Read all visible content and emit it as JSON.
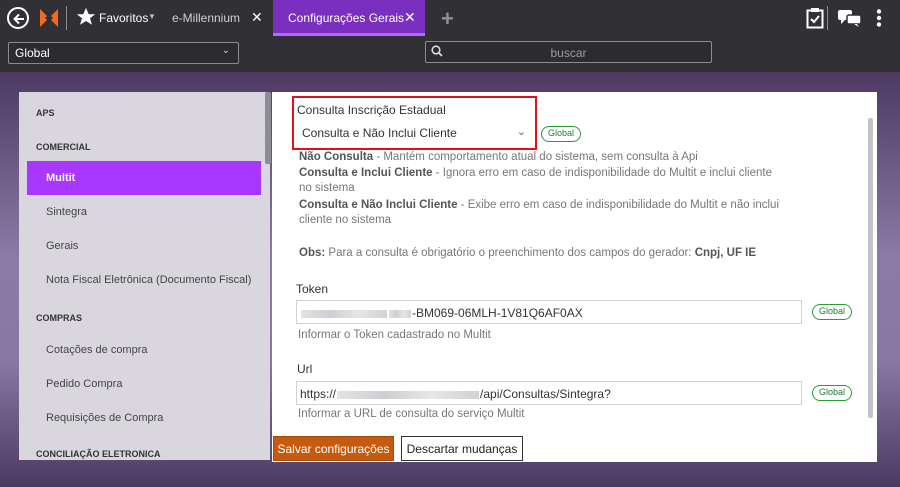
{
  "topbar": {
    "favorites_label": "Favoritos",
    "tabs": [
      {
        "label": "e-Millennium"
      },
      {
        "label": "Configurações Gerais"
      }
    ],
    "icons": {
      "back": "back-circle-icon",
      "logo": "millennium-logo-icon",
      "star": "star-icon",
      "add_tab": "plus-icon",
      "clipboard": "clipboard-check-icon",
      "chat": "chat-icon",
      "more": "more-vertical-icon"
    },
    "accent": "#7b2fbf"
  },
  "subbar": {
    "scope_select_value": "Global",
    "search_placeholder": "buscar"
  },
  "sidebar": {
    "sections": [
      {
        "header": "APS",
        "items": []
      },
      {
        "header": "COMERCIAL",
        "items": [
          {
            "label": "Multit",
            "active": true
          },
          {
            "label": "Sintegra"
          },
          {
            "label": "Gerais"
          },
          {
            "label": "Nota Fiscal Eletrônica (Documento Fiscal)"
          }
        ]
      },
      {
        "header": "COMPRAS",
        "items": [
          {
            "label": "Cotações de compra"
          },
          {
            "label": "Pedido Compra"
          },
          {
            "label": "Requisições de Compra"
          }
        ]
      },
      {
        "header": "CONCILIAÇÃO ELETRONICA",
        "items": []
      }
    ],
    "active_color": "#a838ff"
  },
  "form": {
    "consulta": {
      "label": "Consulta Inscrição Estadual",
      "value": "Consulta e Não Inclui Cliente",
      "badge": "Global",
      "descriptions": [
        {
          "bold": "Não Consulta",
          "text": " - Mantém comportamento atual do sistema, sem consulta à Api"
        },
        {
          "bold": "Consulta e Inclui Cliente",
          "text": " - Ignora erro em caso de indisponibilidade do Multit e inclui cliente no sistema"
        },
        {
          "bold": "Consulta e Não Inclui Cliente",
          "text": " - Exibe erro em caso de indisponibilidade do Multit e não inclui cliente no sistema"
        }
      ],
      "obs_label": "Obs:",
      "obs_text": " Para a consulta é obrigatório o preenchimento dos campos do gerador: ",
      "obs_fields": "Cnpj, UF IE"
    },
    "token": {
      "label": "Token",
      "value_visible": "-BM069-06MLH-1V81Q6AF0AX",
      "badge": "Global",
      "hint": "Informar o Token cadastrado no Multit"
    },
    "url": {
      "label": "Url",
      "value_prefix": "https://",
      "value_suffix": "/api/Consultas/Sintegra?",
      "badge": "Global",
      "hint": "Informar a URL de consulta do serviço Multit"
    },
    "save_label": "Salvar configurações",
    "discard_label": "Descartar mudanças",
    "save_color": "#c55b0f",
    "highlight_color": "#e0101a"
  }
}
